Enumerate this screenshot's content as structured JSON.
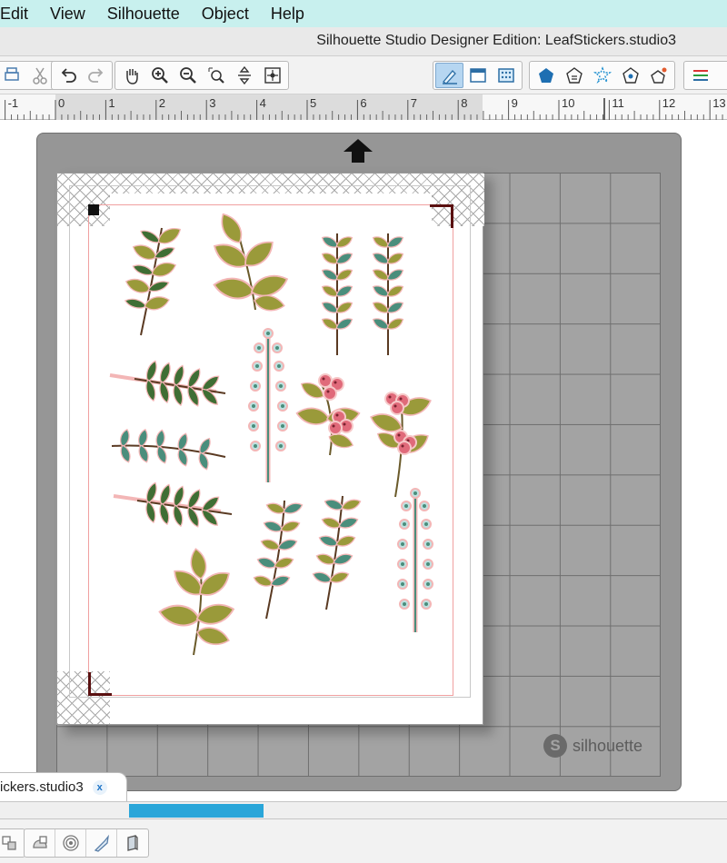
{
  "menu": {
    "items": [
      "Edit",
      "View",
      "Silhouette",
      "Object",
      "Help"
    ]
  },
  "window": {
    "title": "Silhouette Studio Designer Edition: LeafStickers.studio3"
  },
  "ruler": {
    "labels": [
      "-1",
      "0",
      "1",
      "2",
      "3",
      "4",
      "5",
      "6",
      "7",
      "8",
      "9",
      "10",
      "11",
      "12",
      "13"
    ]
  },
  "mat": {
    "brand": "silhouette",
    "brand_mark": "S"
  },
  "document_tab": {
    "label": "ickers.studio3",
    "close": "x"
  },
  "colors": {
    "accent": "#2aa6d9",
    "menubar": "#c8f0ee",
    "mat": "#969696",
    "leaf_olive": "#9a9a3a",
    "leaf_green": "#3f6e34",
    "leaf_teal": "#4a8e7c",
    "berry_pink": "#e06a7a",
    "outline_pink": "#f3b6b6"
  },
  "icons": {
    "toolbar": [
      "print-icon",
      "cut-icon",
      "undo-icon",
      "redo-icon",
      "pan-hand-icon",
      "zoom-in-icon",
      "zoom-out-icon",
      "zoom-select-icon",
      "zoom-drag-icon",
      "fit-page-icon",
      "line-color-icon",
      "fill-color-icon",
      "fill-pattern-icon",
      "shapes-icon",
      "library-icon",
      "rhinestone-icon",
      "store-icon",
      "offset-icon",
      "line-style-icon"
    ],
    "bottom": [
      "group-icon",
      "fill-shape-icon",
      "offset-circles-icon",
      "knife-icon",
      "page-icon"
    ]
  }
}
